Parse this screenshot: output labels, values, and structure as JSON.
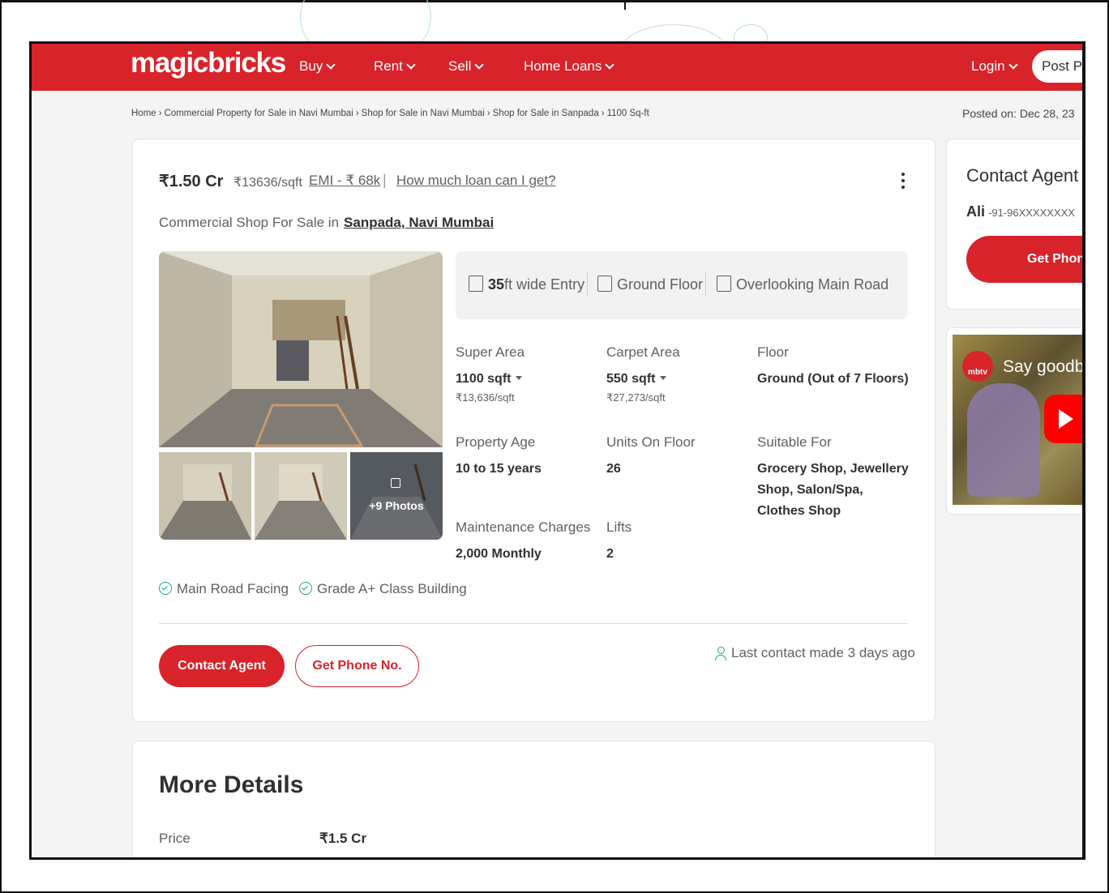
{
  "header": {
    "logo": "magicbricks",
    "nav": [
      {
        "label": "Buy"
      },
      {
        "label": "Rent"
      },
      {
        "label": "Sell"
      },
      {
        "label": "Home Loans"
      }
    ],
    "login_label": "Login",
    "post_label": "Post Pr"
  },
  "breadcrumb": [
    "Home",
    "Commercial Property for Sale in Navi Mumbai",
    "Shop for Sale in Navi Mumbai",
    "Shop for Sale in Sanpada",
    "1100 Sq-ft"
  ],
  "posted_on": "Posted on: Dec 28, 23",
  "listing": {
    "price": "₹1.50 Cr",
    "price_per_sqft": "₹13636/sqft",
    "emi": "EMI - ₹ 68k",
    "loan_link": "How much loan can I get?",
    "subtitle_prefix": "Commercial Shop For Sale in",
    "location": "Sanpada, Navi Mumbai",
    "photos_label": "+9 Photos",
    "highlights": {
      "entry_value": "35",
      "entry_label": "ft wide Entry",
      "floor": "Ground Floor",
      "view": "Overlooking Main Road"
    },
    "specs": [
      {
        "label": "Super Area",
        "value": "1100 sqft",
        "sub": "₹13,636/sqft"
      },
      {
        "label": "Carpet Area",
        "value": "550 sqft",
        "sub": "₹27,273/sqft"
      },
      {
        "label": "Floor",
        "value": "Ground (Out of 7 Floors)",
        "sub": ""
      },
      {
        "label": "Property Age",
        "value": "10 to 15 years",
        "sub": ""
      },
      {
        "label": "Units On Floor",
        "value": "26",
        "sub": ""
      },
      {
        "label": "Suitable For",
        "value": "Grocery Shop, Jewellery Shop, Salon/Spa, Clothes Shop",
        "sub": ""
      },
      {
        "label": "Maintenance Charges",
        "value": "2,000 Monthly",
        "sub": ""
      },
      {
        "label": "Lifts",
        "value": "2",
        "sub": ""
      }
    ],
    "amenities": [
      "Main Road Facing",
      "Grade A+ Class Building"
    ],
    "contact_button": "Contact Agent",
    "phone_button": "Get Phone No.",
    "last_contact": "Last contact made 3 days ago"
  },
  "more_details": {
    "title": "More Details",
    "rows": [
      {
        "label": "Price",
        "value": "₹1.5 Cr"
      }
    ]
  },
  "agent_card": {
    "title": "Contact Agent",
    "name": "Ali",
    "phone": "-91-96XXXXXXXX",
    "button": "Get Phon"
  },
  "video": {
    "logo": "mbtv",
    "title": "Say goodby"
  },
  "colors": {
    "brand": "#d8232a",
    "accent_green": "#18a58d"
  },
  "icons": [
    "chevron-down-icon",
    "kebab-menu-icon",
    "door-icon",
    "floor-icon",
    "road-view-icon",
    "check-circle-icon",
    "person-icon",
    "gallery-icon",
    "play-icon"
  ]
}
